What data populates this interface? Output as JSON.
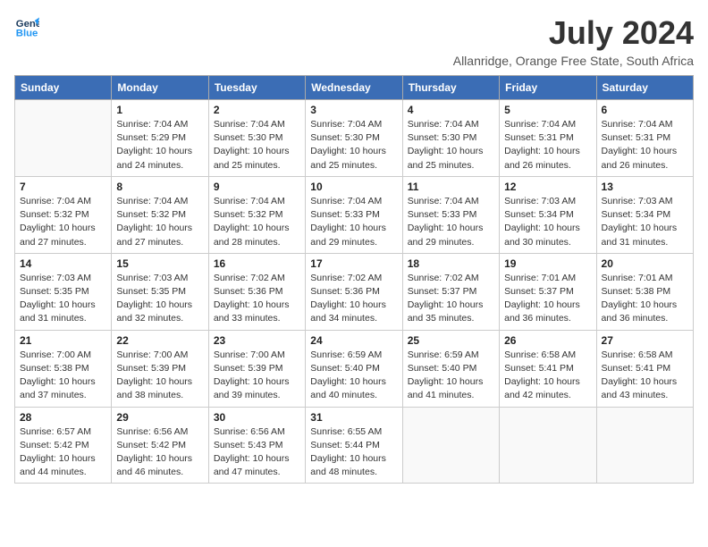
{
  "logo": {
    "line1": "General",
    "line2": "Blue"
  },
  "title": "July 2024",
  "location": "Allanridge, Orange Free State, South Africa",
  "days_of_week": [
    "Sunday",
    "Monday",
    "Tuesday",
    "Wednesday",
    "Thursday",
    "Friday",
    "Saturday"
  ],
  "weeks": [
    [
      {
        "day": "",
        "info": ""
      },
      {
        "day": "1",
        "info": "Sunrise: 7:04 AM\nSunset: 5:29 PM\nDaylight: 10 hours\nand 24 minutes."
      },
      {
        "day": "2",
        "info": "Sunrise: 7:04 AM\nSunset: 5:30 PM\nDaylight: 10 hours\nand 25 minutes."
      },
      {
        "day": "3",
        "info": "Sunrise: 7:04 AM\nSunset: 5:30 PM\nDaylight: 10 hours\nand 25 minutes."
      },
      {
        "day": "4",
        "info": "Sunrise: 7:04 AM\nSunset: 5:30 PM\nDaylight: 10 hours\nand 25 minutes."
      },
      {
        "day": "5",
        "info": "Sunrise: 7:04 AM\nSunset: 5:31 PM\nDaylight: 10 hours\nand 26 minutes."
      },
      {
        "day": "6",
        "info": "Sunrise: 7:04 AM\nSunset: 5:31 PM\nDaylight: 10 hours\nand 26 minutes."
      }
    ],
    [
      {
        "day": "7",
        "info": "Sunrise: 7:04 AM\nSunset: 5:32 PM\nDaylight: 10 hours\nand 27 minutes."
      },
      {
        "day": "8",
        "info": "Sunrise: 7:04 AM\nSunset: 5:32 PM\nDaylight: 10 hours\nand 27 minutes."
      },
      {
        "day": "9",
        "info": "Sunrise: 7:04 AM\nSunset: 5:32 PM\nDaylight: 10 hours\nand 28 minutes."
      },
      {
        "day": "10",
        "info": "Sunrise: 7:04 AM\nSunset: 5:33 PM\nDaylight: 10 hours\nand 29 minutes."
      },
      {
        "day": "11",
        "info": "Sunrise: 7:04 AM\nSunset: 5:33 PM\nDaylight: 10 hours\nand 29 minutes."
      },
      {
        "day": "12",
        "info": "Sunrise: 7:03 AM\nSunset: 5:34 PM\nDaylight: 10 hours\nand 30 minutes."
      },
      {
        "day": "13",
        "info": "Sunrise: 7:03 AM\nSunset: 5:34 PM\nDaylight: 10 hours\nand 31 minutes."
      }
    ],
    [
      {
        "day": "14",
        "info": "Sunrise: 7:03 AM\nSunset: 5:35 PM\nDaylight: 10 hours\nand 31 minutes."
      },
      {
        "day": "15",
        "info": "Sunrise: 7:03 AM\nSunset: 5:35 PM\nDaylight: 10 hours\nand 32 minutes."
      },
      {
        "day": "16",
        "info": "Sunrise: 7:02 AM\nSunset: 5:36 PM\nDaylight: 10 hours\nand 33 minutes."
      },
      {
        "day": "17",
        "info": "Sunrise: 7:02 AM\nSunset: 5:36 PM\nDaylight: 10 hours\nand 34 minutes."
      },
      {
        "day": "18",
        "info": "Sunrise: 7:02 AM\nSunset: 5:37 PM\nDaylight: 10 hours\nand 35 minutes."
      },
      {
        "day": "19",
        "info": "Sunrise: 7:01 AM\nSunset: 5:37 PM\nDaylight: 10 hours\nand 36 minutes."
      },
      {
        "day": "20",
        "info": "Sunrise: 7:01 AM\nSunset: 5:38 PM\nDaylight: 10 hours\nand 36 minutes."
      }
    ],
    [
      {
        "day": "21",
        "info": "Sunrise: 7:00 AM\nSunset: 5:38 PM\nDaylight: 10 hours\nand 37 minutes."
      },
      {
        "day": "22",
        "info": "Sunrise: 7:00 AM\nSunset: 5:39 PM\nDaylight: 10 hours\nand 38 minutes."
      },
      {
        "day": "23",
        "info": "Sunrise: 7:00 AM\nSunset: 5:39 PM\nDaylight: 10 hours\nand 39 minutes."
      },
      {
        "day": "24",
        "info": "Sunrise: 6:59 AM\nSunset: 5:40 PM\nDaylight: 10 hours\nand 40 minutes."
      },
      {
        "day": "25",
        "info": "Sunrise: 6:59 AM\nSunset: 5:40 PM\nDaylight: 10 hours\nand 41 minutes."
      },
      {
        "day": "26",
        "info": "Sunrise: 6:58 AM\nSunset: 5:41 PM\nDaylight: 10 hours\nand 42 minutes."
      },
      {
        "day": "27",
        "info": "Sunrise: 6:58 AM\nSunset: 5:41 PM\nDaylight: 10 hours\nand 43 minutes."
      }
    ],
    [
      {
        "day": "28",
        "info": "Sunrise: 6:57 AM\nSunset: 5:42 PM\nDaylight: 10 hours\nand 44 minutes."
      },
      {
        "day": "29",
        "info": "Sunrise: 6:56 AM\nSunset: 5:42 PM\nDaylight: 10 hours\nand 46 minutes."
      },
      {
        "day": "30",
        "info": "Sunrise: 6:56 AM\nSunset: 5:43 PM\nDaylight: 10 hours\nand 47 minutes."
      },
      {
        "day": "31",
        "info": "Sunrise: 6:55 AM\nSunset: 5:44 PM\nDaylight: 10 hours\nand 48 minutes."
      },
      {
        "day": "",
        "info": ""
      },
      {
        "day": "",
        "info": ""
      },
      {
        "day": "",
        "info": ""
      }
    ]
  ]
}
